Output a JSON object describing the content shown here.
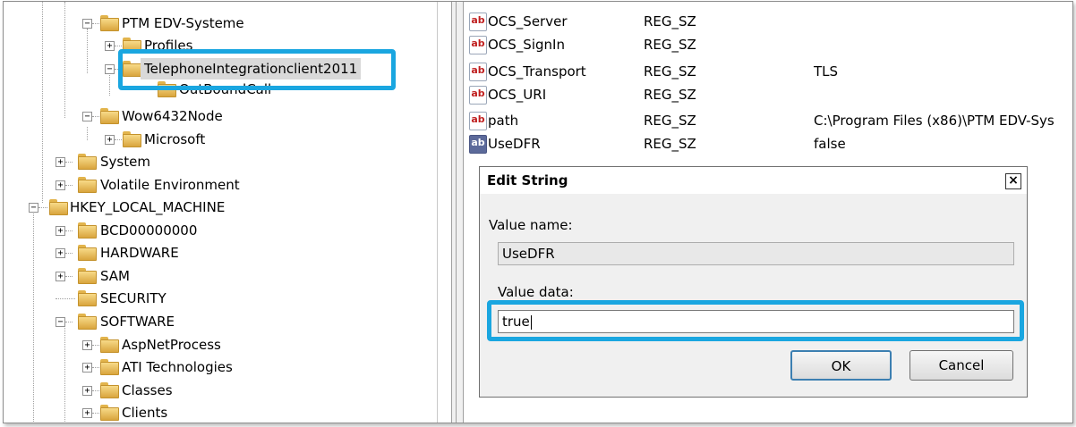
{
  "tree": {
    "nodes": [
      {
        "label": "PTM EDV-Systeme",
        "expander": "−"
      },
      {
        "label": "Profiles",
        "expander": "+"
      },
      {
        "label": "TelephoneIntegrationclient2011",
        "expander": "−"
      },
      {
        "label": "OutBoundCall",
        "expander": ""
      },
      {
        "label": "Wow6432Node",
        "expander": "−"
      },
      {
        "label": "Microsoft",
        "expander": "+"
      },
      {
        "label": "System",
        "expander": "+"
      },
      {
        "label": "Volatile Environment",
        "expander": "+"
      },
      {
        "label": "HKEY_LOCAL_MACHINE",
        "expander": "−"
      },
      {
        "label": "BCD00000000",
        "expander": "+"
      },
      {
        "label": "HARDWARE",
        "expander": "+"
      },
      {
        "label": "SAM",
        "expander": "+"
      },
      {
        "label": "SECURITY",
        "expander": ""
      },
      {
        "label": "SOFTWARE",
        "expander": "−"
      },
      {
        "label": "AspNetProcess",
        "expander": "+"
      },
      {
        "label": "ATI Technologies",
        "expander": "+"
      },
      {
        "label": "Classes",
        "expander": "+"
      },
      {
        "label": "Clients",
        "expander": "+"
      }
    ]
  },
  "values": [
    {
      "name": "OCS_Server",
      "type": "REG_SZ",
      "data": ""
    },
    {
      "name": "OCS_SignIn",
      "type": "REG_SZ",
      "data": ""
    },
    {
      "name": "OCS_Transport",
      "type": "REG_SZ",
      "data": "TLS"
    },
    {
      "name": "OCS_URI",
      "type": "REG_SZ",
      "data": ""
    },
    {
      "name": "path",
      "type": "REG_SZ",
      "data": "C:\\Program Files (x86)\\PTM EDV-Sys"
    },
    {
      "name": "UseDFR",
      "type": "REG_SZ",
      "data": "false"
    }
  ],
  "dialog": {
    "title": "Edit String",
    "close_glyph": "×",
    "value_name_label": "Value name:",
    "value_name": "UseDFR",
    "value_data_label": "Value data:",
    "value_data": "true",
    "ok_label": "OK",
    "cancel_label": "Cancel"
  },
  "icons": {
    "string_value": "ab"
  },
  "colors": {
    "highlight": "#1aa6e0",
    "ab_text": "#c02020"
  }
}
